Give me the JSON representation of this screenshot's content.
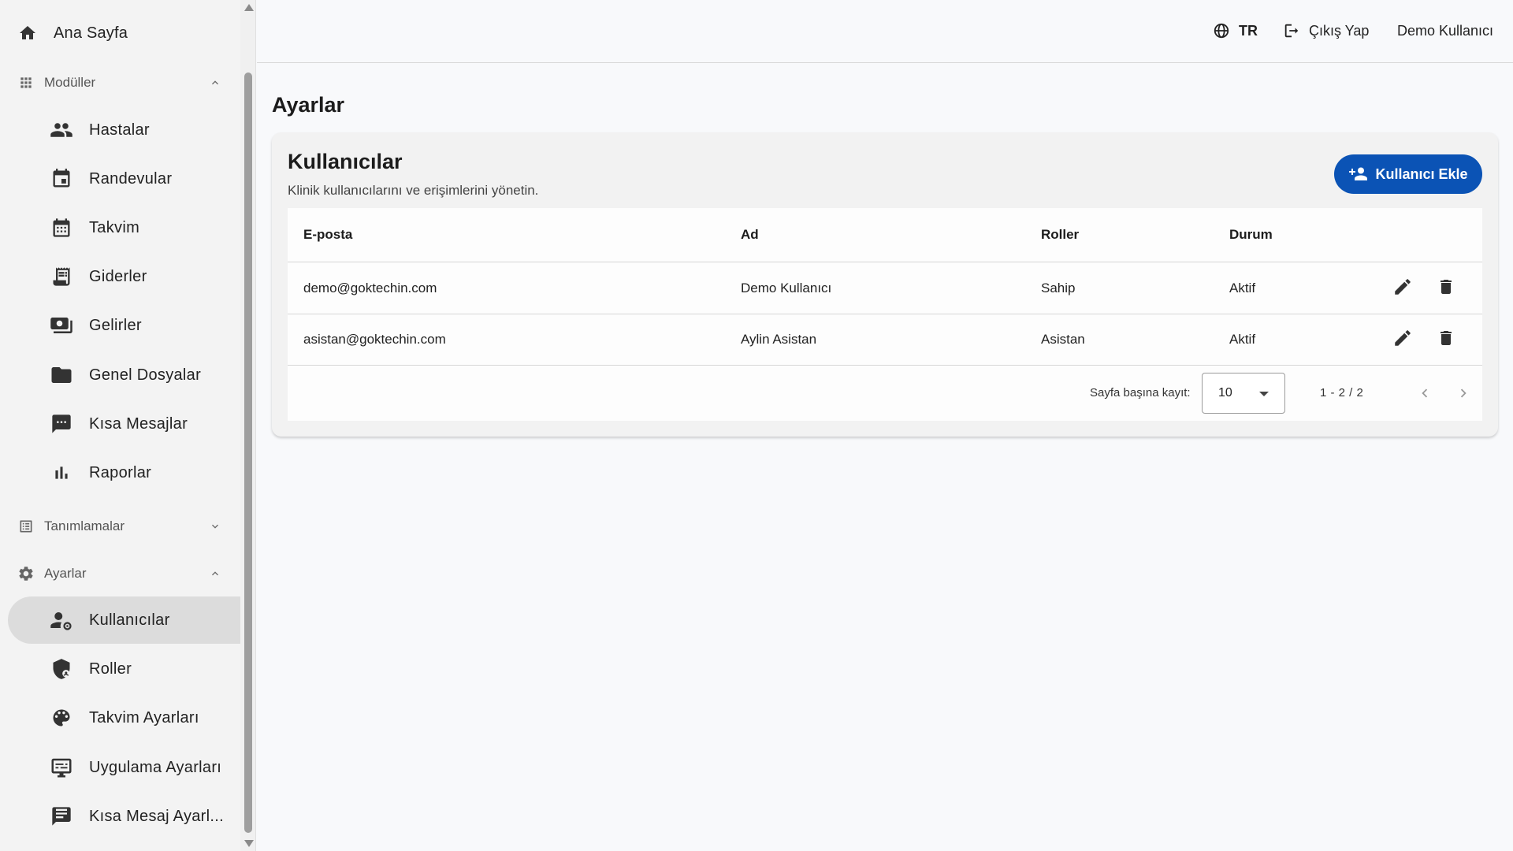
{
  "sidebar": {
    "home": {
      "label": "Ana Sayfa",
      "icon": "home-icon"
    },
    "sections": {
      "modules": {
        "label": "Modüller",
        "icon": "apps-grid-icon",
        "expanded": true
      },
      "definitions": {
        "label": "Tanımlamalar",
        "icon": "list-icon",
        "expanded": false
      },
      "settings": {
        "label": "Ayarlar",
        "icon": "gear-icon",
        "expanded": true
      }
    },
    "modules": [
      {
        "label": "Hastalar",
        "icon": "people-icon"
      },
      {
        "label": "Randevular",
        "icon": "calendar-event-icon"
      },
      {
        "label": "Takvim",
        "icon": "calendar-month-icon"
      },
      {
        "label": "Giderler",
        "icon": "receipt-icon"
      },
      {
        "label": "Gelirler",
        "icon": "payments-icon"
      },
      {
        "label": "Genel Dosyalar",
        "icon": "folder-icon"
      },
      {
        "label": "Kısa Mesajlar",
        "icon": "sms-icon"
      },
      {
        "label": "Raporlar",
        "icon": "bar-chart-icon"
      }
    ],
    "settings": [
      {
        "label": "Kullanıcılar",
        "icon": "manage-accounts-icon",
        "active": true
      },
      {
        "label": "Roller",
        "icon": "shield-icon"
      },
      {
        "label": "Takvim Ayarları",
        "icon": "palette-icon"
      },
      {
        "label": "Uygulama Ayarları",
        "icon": "settings-display-icon"
      },
      {
        "label": "Kısa Mesaj Ayarl...",
        "icon": "message-settings-icon"
      }
    ]
  },
  "header": {
    "language": "TR",
    "logout": "Çıkış Yap",
    "user": "Demo Kullanıcı"
  },
  "page": {
    "title": "Ayarlar"
  },
  "users_card": {
    "title": "Kullanıcılar",
    "subtitle": "Klinik kullanıcılarını ve erişimlerini yönetin.",
    "add_button": "Kullanıcı Ekle",
    "columns": {
      "email": "E-posta",
      "name": "Ad",
      "roles": "Roller",
      "status": "Durum"
    },
    "rows": [
      {
        "email": "demo@goktechin.com",
        "name": "Demo Kullanıcı",
        "roles": "Sahip",
        "status": "Aktif"
      },
      {
        "email": "asistan@goktechin.com",
        "name": "Aylin Asistan",
        "roles": "Asistan",
        "status": "Aktif"
      }
    ],
    "pagination": {
      "rows_per_page_label": "Sayfa başına kayıt:",
      "rows_per_page": "10",
      "range": "1 - 2 / 2"
    }
  },
  "colors": {
    "accent": "#0b53b5",
    "active_nav": "#dcdcdc",
    "sidebar_bg": "#f3f3f3"
  }
}
